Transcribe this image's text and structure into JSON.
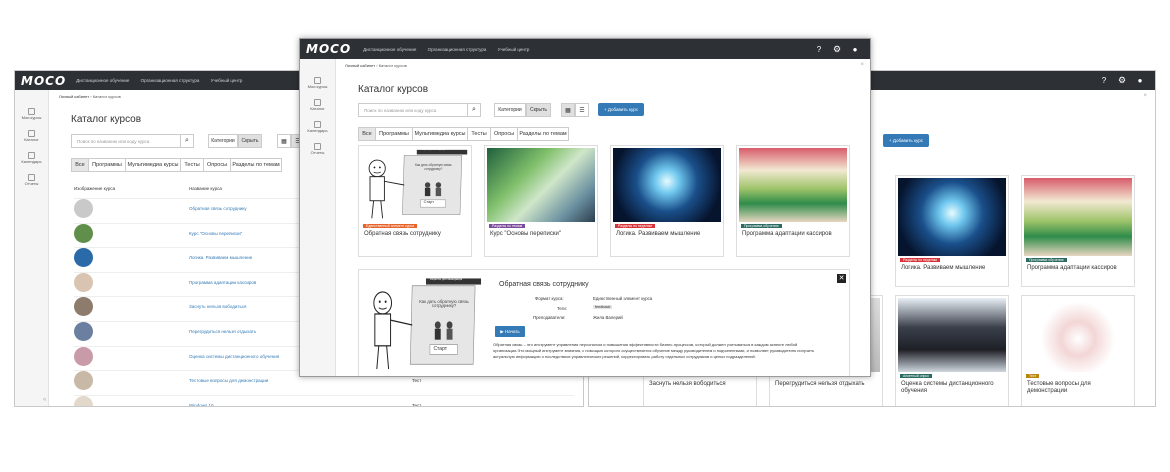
{
  "app": {
    "logo": "MOCO",
    "nav": [
      "Дистанционное обучение",
      "Организационная структура",
      "Учебный центр"
    ]
  },
  "icons": {
    "help": "help-icon",
    "settings": "gear-icon",
    "user": "user-icon",
    "close": "close-icon"
  },
  "sidebar": [
    {
      "label": "Мои курсы",
      "icon": "my-courses-icon"
    },
    {
      "label": "Каталог",
      "icon": "catalog-icon"
    },
    {
      "label": "Календарь",
      "icon": "calendar-icon"
    },
    {
      "label": "Отчеты",
      "icon": "reports-icon"
    }
  ],
  "breadcrumb": {
    "home": "Личный кабинет",
    "sep": "›",
    "current": "Каталог курсов"
  },
  "page_title": "Каталог курсов",
  "search": {
    "placeholder": "Поиск по названию или коду курса"
  },
  "toggle": {
    "categories": "Категории",
    "hide": "Скрыть"
  },
  "add_course": "+ Добавить курс",
  "tabs": [
    "Все",
    "Программы",
    "Мультимедиа курсы",
    "Тесты",
    "Опросы",
    "Разделы по темам"
  ],
  "table": {
    "headers": {
      "image": "Изображение курса",
      "name": "Название курса"
    },
    "rows": [
      {
        "name": "Обратная связь сотруднику",
        "type": ""
      },
      {
        "name": "Курс \"Основы переписки\"",
        "type": ""
      },
      {
        "name": "Логика. Развиваем мышление",
        "type": ""
      },
      {
        "name": "Программа адаптации кассиров",
        "type": ""
      },
      {
        "name": "Заснуть нельзя вободиться",
        "type": ""
      },
      {
        "name": "Перегрудиться нельзя отдыхать",
        "type": ""
      },
      {
        "name": "Оценка системы дистанционного обучения",
        "type": ""
      },
      {
        "name": "Тестовые вопросы для демонстрации",
        "type": "Тест"
      },
      {
        "name": "Windows 10",
        "type": "Тест"
      }
    ]
  },
  "cards_top": [
    {
      "badge": "Единственный элемент курса",
      "badge_color": "#e8632a",
      "title": "Обратная связь сотруднику"
    },
    {
      "badge": "Разделы по темам",
      "badge_color": "#7b4b9c",
      "title": "Курс \"Основы переписки\""
    },
    {
      "badge": "Разделы по неделям",
      "badge_color": "#d9343a",
      "title": "Логика. Развиваем мышление"
    },
    {
      "badge": "Программа обучения",
      "badge_color": "#2c6b62",
      "title": "Программа адаптации кассиров"
    }
  ],
  "cards_right": [
    {
      "badge": "Разделы по неделям",
      "badge_color": "#d9343a",
      "title": "Логика. Развиваем мышление"
    },
    {
      "badge": "Программа обучения",
      "badge_color": "#2c6b62",
      "title": "Программа адаптации кассиров"
    }
  ],
  "cards_right_bottom": [
    {
      "badge": "",
      "title": "Заснуть нельзя вободиться"
    },
    {
      "badge": "",
      "title": "Перегрудиться нельзя отдыхать"
    },
    {
      "badge": "Анкетный опрос",
      "badge_color": "#2c6b62",
      "title": "Оценка системы дистанционного обучения"
    },
    {
      "badge": "Тест",
      "badge_color": "#b8860b",
      "title": "Тестовые вопросы для демонстрации"
    }
  ],
  "detail": {
    "title": "Обратная связь сотруднику",
    "format_label": "Формат курса:",
    "format_value": "Единственный элемент курса",
    "tags_label": "Теги:",
    "tags_value": "feedback",
    "teachers_label": "Преподаватели:",
    "teachers_value": "Жила Валерий",
    "start_button": "▶ Начать",
    "description": "Обратная связь – это инструмент управления персоналом и повышения эффективности бизнес-процессов, который должен учитываться в каждом аспекте любой организации.Это мощный инструмент влияния, с помощью которого осуществляется обучение между руководителем и подчиненными, и позволяет руководителю получить актуальную информацию о последствиях управленческих решений, корректировать работу отдельных сотрудников и целых подразделений."
  },
  "illustration": {
    "question": "Как дать обратную связь сотруднику?",
    "start": "Старт",
    "banner": "Рецепты для менеджера"
  },
  "colors": {
    "topbar": "#2d3035",
    "accent": "#337ab7"
  }
}
